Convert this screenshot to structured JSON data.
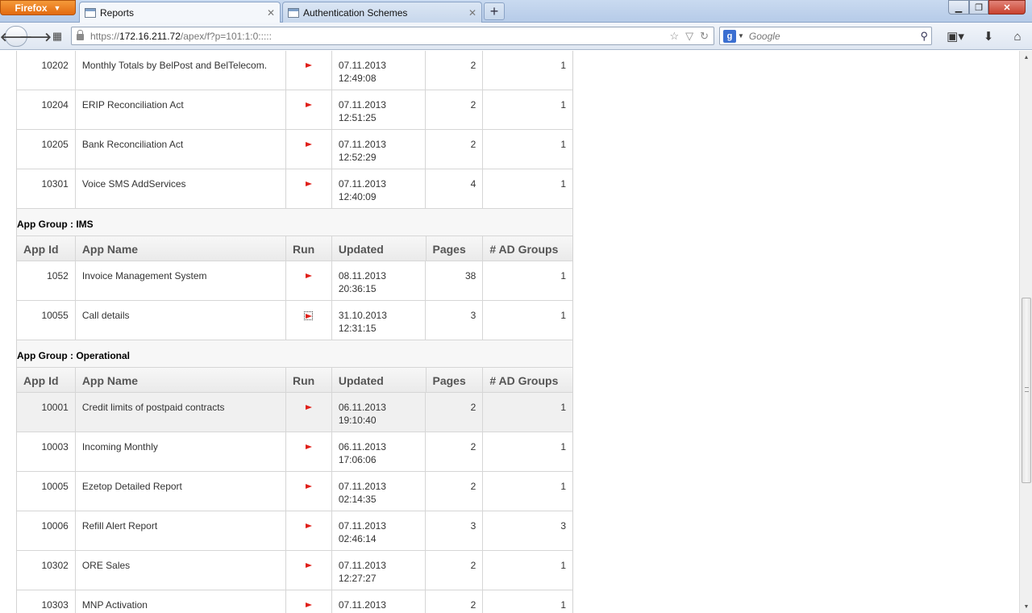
{
  "browser": {
    "firefox_label": "Firefox",
    "tabs": [
      {
        "label": "Reports",
        "active": true
      },
      {
        "label": "Authentication Schemes",
        "active": false
      }
    ],
    "url_prefix": "https://",
    "url_host": "172.16.211.72",
    "url_path": "/apex/f?p=101:1:0:::::",
    "search_placeholder": "Google",
    "google_letter": "g"
  },
  "table": {
    "headers": {
      "app_id": "App Id",
      "app_name": "App Name",
      "run": "Run",
      "updated": "Updated",
      "pages": "Pages",
      "ad_groups": "# AD Groups"
    },
    "top_rows": [
      {
        "id": "10202",
        "name": "Monthly Totals by BelPost and BelTelecom.",
        "date": "07.11.2013",
        "time": "12:49:08",
        "pages": "2",
        "ad": "1"
      },
      {
        "id": "10204",
        "name": "ERIP Reconciliation Act",
        "date": "07.11.2013",
        "time": "12:51:25",
        "pages": "2",
        "ad": "1"
      },
      {
        "id": "10205",
        "name": "Bank Reconciliation Act",
        "date": "07.11.2013",
        "time": "12:52:29",
        "pages": "2",
        "ad": "1"
      },
      {
        "id": "10301",
        "name": "Voice SMS AddServices",
        "date": "07.11.2013",
        "time": "12:40:09",
        "pages": "4",
        "ad": "1"
      }
    ],
    "group_ims": {
      "label": "App Group : IMS",
      "rows": [
        {
          "id": "1052",
          "name": "Invoice Management System",
          "date": "08.11.2013",
          "time": "20:36:15",
          "pages": "38",
          "ad": "1"
        },
        {
          "id": "10055",
          "name": "Call details",
          "date": "31.10.2013",
          "time": "12:31:15",
          "pages": "3",
          "ad": "1"
        }
      ]
    },
    "group_operational": {
      "label": "App Group : Operational",
      "rows": [
        {
          "id": "10001",
          "name": "Credit limits of postpaid contracts",
          "date": "06.11.2013",
          "time": "19:10:40",
          "pages": "2",
          "ad": "1"
        },
        {
          "id": "10003",
          "name": "Incoming Monthly",
          "date": "06.11.2013",
          "time": "17:06:06",
          "pages": "2",
          "ad": "1"
        },
        {
          "id": "10005",
          "name": "Ezetop Detailed Report",
          "date": "07.11.2013",
          "time": "02:14:35",
          "pages": "2",
          "ad": "1"
        },
        {
          "id": "10006",
          "name": "Refill Alert Report",
          "date": "07.11.2013",
          "time": "02:46:14",
          "pages": "3",
          "ad": "3"
        },
        {
          "id": "10302",
          "name": "ORE Sales",
          "date": "07.11.2013",
          "time": "12:27:27",
          "pages": "2",
          "ad": "1"
        },
        {
          "id": "10303",
          "name": "MNP Activation",
          "date": "07.11.2013",
          "time": "",
          "pages": "2",
          "ad": "1"
        }
      ]
    }
  },
  "colors": {
    "run_arrow": "#e0201a",
    "row_highlight": "#f0f0f0"
  }
}
